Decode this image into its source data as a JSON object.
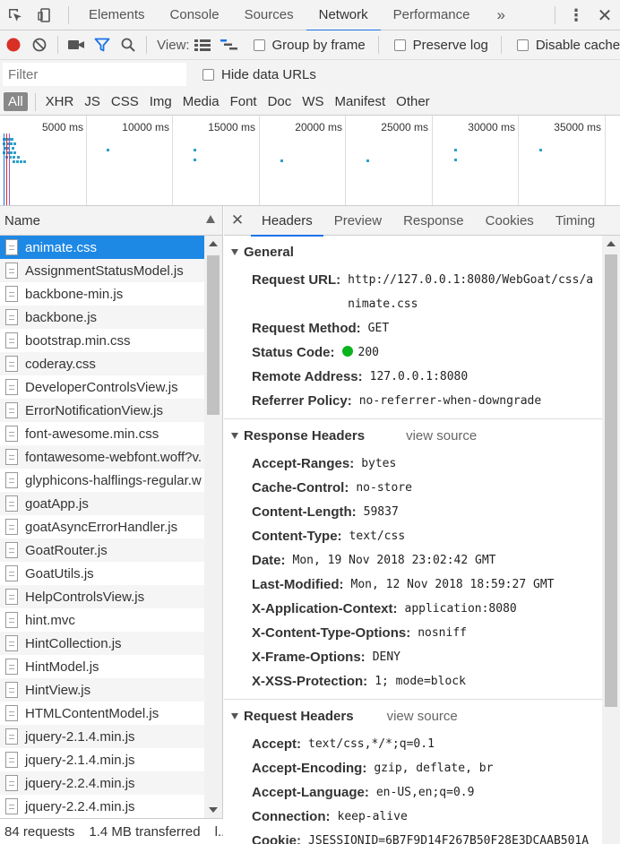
{
  "toptabs": [
    "Elements",
    "Console",
    "Sources",
    "Network",
    "Performance"
  ],
  "more_label": "»",
  "toolbar": {
    "view_label": "View:",
    "group_by_frame": "Group by frame",
    "preserve_log": "Preserve log",
    "disable_cache": "Disable cache"
  },
  "filter": {
    "placeholder": "Filter",
    "hide_data_urls": "Hide data URLs"
  },
  "types": [
    "All",
    "XHR",
    "JS",
    "CSS",
    "Img",
    "Media",
    "Font",
    "Doc",
    "WS",
    "Manifest",
    "Other"
  ],
  "overview": {
    "labels": [
      "5000 ms",
      "10000 ms",
      "15000 ms",
      "20000 ms",
      "25000 ms",
      "30000 ms",
      "35000 ms"
    ]
  },
  "name_header": "Name",
  "files": [
    "animate.css",
    "AssignmentStatusModel.js",
    "backbone-min.js",
    "backbone.js",
    "bootstrap.min.css",
    "coderay.css",
    "DeveloperControlsView.js",
    "ErrorNotificationView.js",
    "font-awesome.min.css",
    "fontawesome-webfont.woff?v.",
    "glyphicons-halflings-regular.w",
    "goatApp.js",
    "goatAsyncErrorHandler.js",
    "GoatRouter.js",
    "GoatUtils.js",
    "HelpControlsView.js",
    "hint.mvc",
    "HintCollection.js",
    "HintModel.js",
    "HintView.js",
    "HTMLContentModel.js",
    "jquery-2.1.4.min.js",
    "jquery-2.1.4.min.js",
    "jquery-2.2.4.min.js",
    "jquery-2.2.4.min.js"
  ],
  "status": {
    "requests": "84 requests",
    "transferred": "1.4 MB transferred",
    "extra": "l..."
  },
  "detail_tabs": [
    "Headers",
    "Preview",
    "Response",
    "Cookies",
    "Timing"
  ],
  "general": {
    "title": "General",
    "request_url_label": "Request URL:",
    "request_url": "http://127.0.0.1:8080/WebGoat/css/animate.css",
    "request_method_label": "Request Method:",
    "request_method": "GET",
    "status_code_label": "Status Code:",
    "status_code": "200",
    "remote_address_label": "Remote Address:",
    "remote_address": "127.0.0.1:8080",
    "referrer_policy_label": "Referrer Policy:",
    "referrer_policy": "no-referrer-when-downgrade"
  },
  "response_headers": {
    "title": "Response Headers",
    "view_source": "view source",
    "items": [
      {
        "name": "Accept-Ranges:",
        "value": "bytes"
      },
      {
        "name": "Cache-Control:",
        "value": "no-store"
      },
      {
        "name": "Content-Length:",
        "value": "59837"
      },
      {
        "name": "Content-Type:",
        "value": "text/css"
      },
      {
        "name": "Date:",
        "value": "Mon, 19 Nov 2018 23:02:42 GMT"
      },
      {
        "name": "Last-Modified:",
        "value": "Mon, 12 Nov 2018 18:59:27 GMT"
      },
      {
        "name": "X-Application-Context:",
        "value": "application:8080"
      },
      {
        "name": "X-Content-Type-Options:",
        "value": "nosniff"
      },
      {
        "name": "X-Frame-Options:",
        "value": "DENY"
      },
      {
        "name": "X-XSS-Protection:",
        "value": "1; mode=block"
      }
    ]
  },
  "request_headers": {
    "title": "Request Headers",
    "view_source": "view source",
    "items": [
      {
        "name": "Accept:",
        "value": "text/css,*/*;q=0.1"
      },
      {
        "name": "Accept-Encoding:",
        "value": "gzip, deflate, br"
      },
      {
        "name": "Accept-Language:",
        "value": "en-US,en;q=0.9"
      },
      {
        "name": "Connection:",
        "value": "keep-alive"
      },
      {
        "name": "Cookie:",
        "value": "JSESSIONID=6B7F9D14F267B50F28E3DCAAB501A"
      }
    ]
  },
  "colors": {
    "accent": "#1a73e8",
    "selected_row": "#1e88e5",
    "record": "#d93025",
    "status_ok": "#0bb31c"
  }
}
